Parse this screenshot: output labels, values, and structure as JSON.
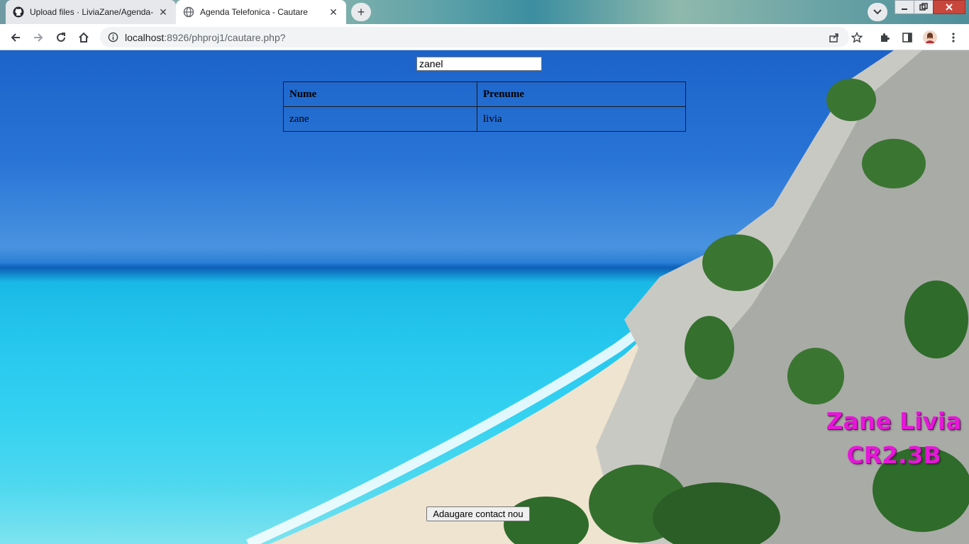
{
  "browser": {
    "tabs": [
      {
        "title": "Upload files · LiviaZane/Agenda-",
        "icon": "github-icon",
        "active": false
      },
      {
        "title": "Agenda Telefonica - Cautare",
        "icon": "globe-icon",
        "active": true
      }
    ],
    "url_host": "localhost",
    "url_path": ":8926/phproj1/cautare.php?"
  },
  "page": {
    "search_value": "zanel",
    "table": {
      "headers": [
        "Nume",
        "Prenume"
      ],
      "rows": [
        [
          "zane",
          "livia"
        ]
      ]
    },
    "signature": {
      "line1": "Zane Livia",
      "line2": "CR2.3B",
      "color": "#e617d8"
    },
    "add_button": "Adaugare contact nou"
  }
}
